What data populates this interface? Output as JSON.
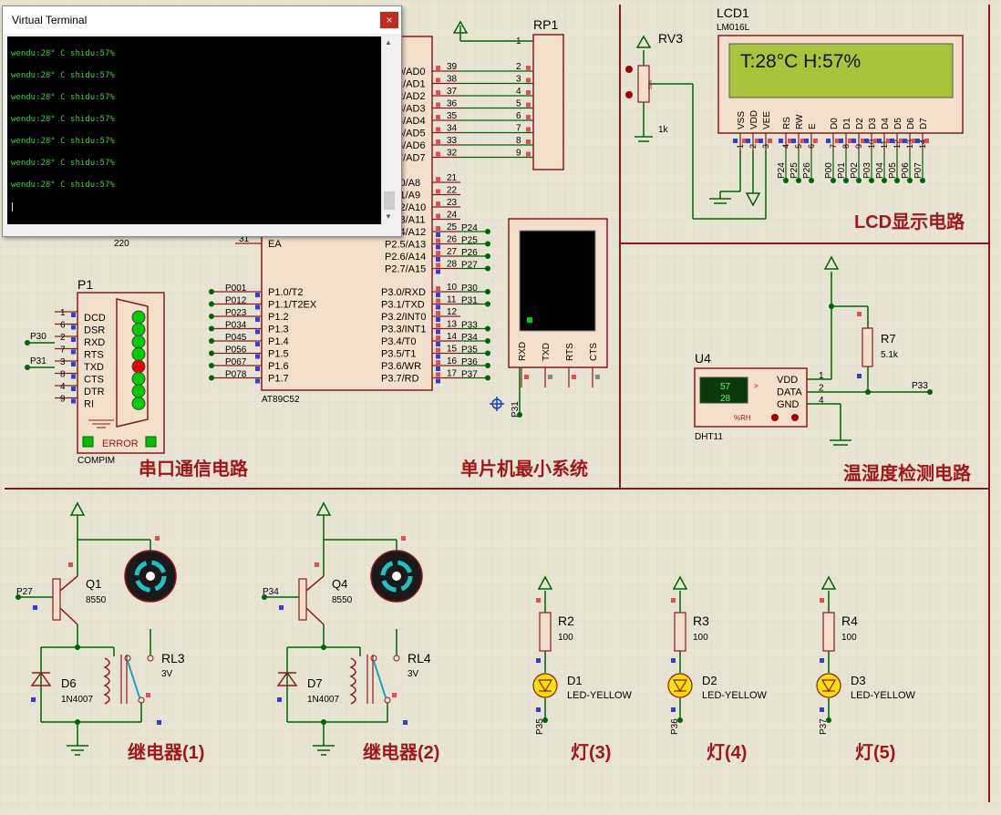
{
  "terminal": {
    "title": "Virtual Terminal",
    "close_glyph": "×",
    "lines": [
      "wendu:28° C shidu:57%",
      "wendu:28° C shidu:57%",
      "wendu:28° C shidu:57%",
      "wendu:28° C shidu:57%",
      "wendu:28° C shidu:57%",
      "wendu:28° C shidu:57%",
      "wendu:28° C shidu:57%"
    ]
  },
  "sections": {
    "serial": "串口通信电路",
    "mcu": "单片机最小系统",
    "lcd": "LCD显示电路",
    "sensor": "温湿度检测电路",
    "relay1": "继电器(1)",
    "relay2": "继电器(2)",
    "lamp3": "灯(3)",
    "lamp4": "灯(4)",
    "lamp5": "灯(5)"
  },
  "mcu": {
    "part": "AT89C52",
    "p0_pins": [
      "39",
      "38",
      "37",
      "36",
      "35",
      "34",
      "33",
      "32"
    ],
    "p0_labels": [
      "0/AD0",
      "1/AD1",
      "2/AD2",
      "3/AD3",
      "4/AD4",
      "5/AD5",
      "6/AD6",
      "7/AD7"
    ],
    "p2_pins": [
      "21",
      "22",
      "23",
      "24",
      "25",
      "26",
      "27",
      "28"
    ],
    "p2_labels": [
      "P2.0/A8",
      "P2.1/A9",
      "P2.2/A10",
      "P2.3/A11",
      "P2.4/A12",
      "P2.5/A13",
      "P2.6/A14",
      "P2.7/A15"
    ],
    "p2_nets": [
      "",
      "",
      "",
      "",
      "P24",
      "P25",
      "P26",
      "P27"
    ],
    "p3_pins": [
      "10",
      "11",
      "12",
      "13",
      "14",
      "15",
      "16",
      "17"
    ],
    "p3_labels": [
      "P3.0/RXD",
      "P3.1/TXD",
      "P3.2/INT0",
      "P3.3/INT1",
      "P3.4/T0",
      "P3.5/T1",
      "P3.6/WR",
      "P3.7/RD"
    ],
    "p3_nets": [
      "P30",
      "P31",
      "",
      "P33",
      "P34",
      "P35",
      "P36",
      "P37"
    ],
    "p1_labels": [
      "P1.0/T2",
      "P1.1/T2EX",
      "P1.2",
      "P1.3",
      "P1.4",
      "P1.5",
      "P1.6",
      "P1.7"
    ],
    "p1_nets": [
      "P001",
      "P012",
      "P023",
      "P034",
      "P045",
      "P056",
      "P067",
      "P078"
    ],
    "ale": "ALE",
    "ea": "EA",
    "ea_pin": "31",
    "ale_pin": "30",
    "r_value": "220"
  },
  "rp1": {
    "name": "RP1",
    "pins": [
      "1",
      "2",
      "3",
      "4",
      "5",
      "6",
      "7",
      "8",
      "9"
    ]
  },
  "rv3": {
    "name": "RV3",
    "value": "1k",
    "percent": "33%"
  },
  "lcd": {
    "name": "LCD1",
    "model": "LM016L",
    "display_text": "T:28°C  H:57%",
    "pin_labels": [
      "VSS",
      "VDD",
      "VEE",
      "RS",
      "RW",
      "E",
      "D0",
      "D1",
      "D2",
      "D3",
      "D4",
      "D5",
      "D6",
      "D7"
    ],
    "pin_numbers": [
      "1",
      "2",
      "3",
      "4",
      "5",
      "6",
      "7",
      "8",
      "9",
      "10",
      "11",
      "12",
      "13",
      "14"
    ],
    "nets": [
      "P24",
      "P25",
      "P26",
      "P00",
      "P01",
      "P02",
      "P03",
      "P04",
      "P05",
      "P06",
      "P07"
    ]
  },
  "vterm_small": {
    "pins": [
      "RXD",
      "TXD",
      "RTS",
      "CTS"
    ],
    "net": "P31"
  },
  "p1": {
    "name": "P1",
    "model": "COMPIM",
    "error": "ERROR",
    "pins": [
      {
        "num": "1",
        "label": "DCD",
        "led": "green"
      },
      {
        "num": "6",
        "label": "DSR",
        "led": "green"
      },
      {
        "num": "2",
        "label": "RXD",
        "led": "green"
      },
      {
        "num": "7",
        "label": "RTS",
        "led": "green"
      },
      {
        "num": "3",
        "label": "TXD",
        "led": "red"
      },
      {
        "num": "8",
        "label": "CTS",
        "led": "green"
      },
      {
        "num": "4",
        "label": "DTR",
        "led": "green"
      },
      {
        "num": "9",
        "label": "RI",
        "led": "green"
      }
    ],
    "net_rx": "P30",
    "net_tx": "P31"
  },
  "u4": {
    "name": "U4",
    "model": "DHT11",
    "humidity": "57",
    "temperature": "28",
    "rh_label": "%RH",
    "pins": [
      {
        "num": "1",
        "label": "VDD"
      },
      {
        "num": "2",
        "label": "DATA"
      },
      {
        "num": "4",
        "label": "GND"
      }
    ],
    "net": "P33",
    "pullup_name": "R7",
    "pullup_value": "5.1k"
  },
  "relays": [
    {
      "transistor": "Q1",
      "t_model": "8550",
      "net": "P27",
      "diode": "D6",
      "d_model": "1N4007",
      "relay": "RL3",
      "r_volt": "3V"
    },
    {
      "transistor": "Q4",
      "t_model": "8550",
      "net": "P34",
      "diode": "D7",
      "d_model": "1N4007",
      "relay": "RL4",
      "r_volt": "3V"
    }
  ],
  "lamps": [
    {
      "res": "R2",
      "rval": "100",
      "led": "D1",
      "lmodel": "LED-YELLOW",
      "net": "P35"
    },
    {
      "res": "R3",
      "rval": "100",
      "led": "D2",
      "lmodel": "LED-YELLOW",
      "net": "P36"
    },
    {
      "res": "R4",
      "rval": "100",
      "led": "D3",
      "lmodel": "LED-YELLOW",
      "net": "P37"
    }
  ],
  "colors": {
    "background": "#e8e4d4",
    "wire": "#006400",
    "component": "#8b1a1a",
    "body_fill": "#f2e0cc",
    "title_text": "#a01818",
    "lcd_screen": "#a8c43a",
    "led_green": "#00cc00",
    "led_red": "#e00000",
    "led_yellow": "#ffe000",
    "terminal_text": "#3cd23c"
  }
}
